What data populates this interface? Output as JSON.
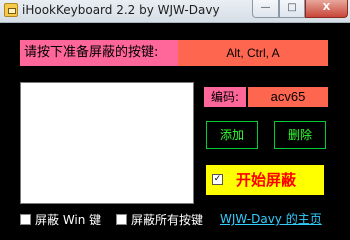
{
  "window": {
    "title": "iHookKeyboard 2.2 by WJW-Davy",
    "icon": "keyboard-app-icon",
    "controls": {
      "minimize": "—",
      "maximize": "□",
      "close": "X"
    }
  },
  "hotkey": {
    "label": "请按下准备屏蔽的按键:",
    "value": "Alt, Ctrl, A"
  },
  "code": {
    "label": "编码:",
    "value": "acv65"
  },
  "buttons": {
    "add": "添加",
    "delete": "删除",
    "start": "开始屏蔽"
  },
  "start_checkbox": {
    "checked": true,
    "mark": "✓"
  },
  "options": {
    "block_win_key": "屏蔽 Win 键",
    "block_all_keys": "屏蔽所有按键"
  },
  "link": {
    "homepage": "WJW-Davy 的主页"
  },
  "colors": {
    "background": "#000000",
    "label_pink": "#ff6699",
    "value_red": "#ff6650",
    "button_green": "#33ff33",
    "start_yellow": "#ffff00",
    "start_text_red": "#ff0000",
    "link_cyan": "#33ccff"
  }
}
